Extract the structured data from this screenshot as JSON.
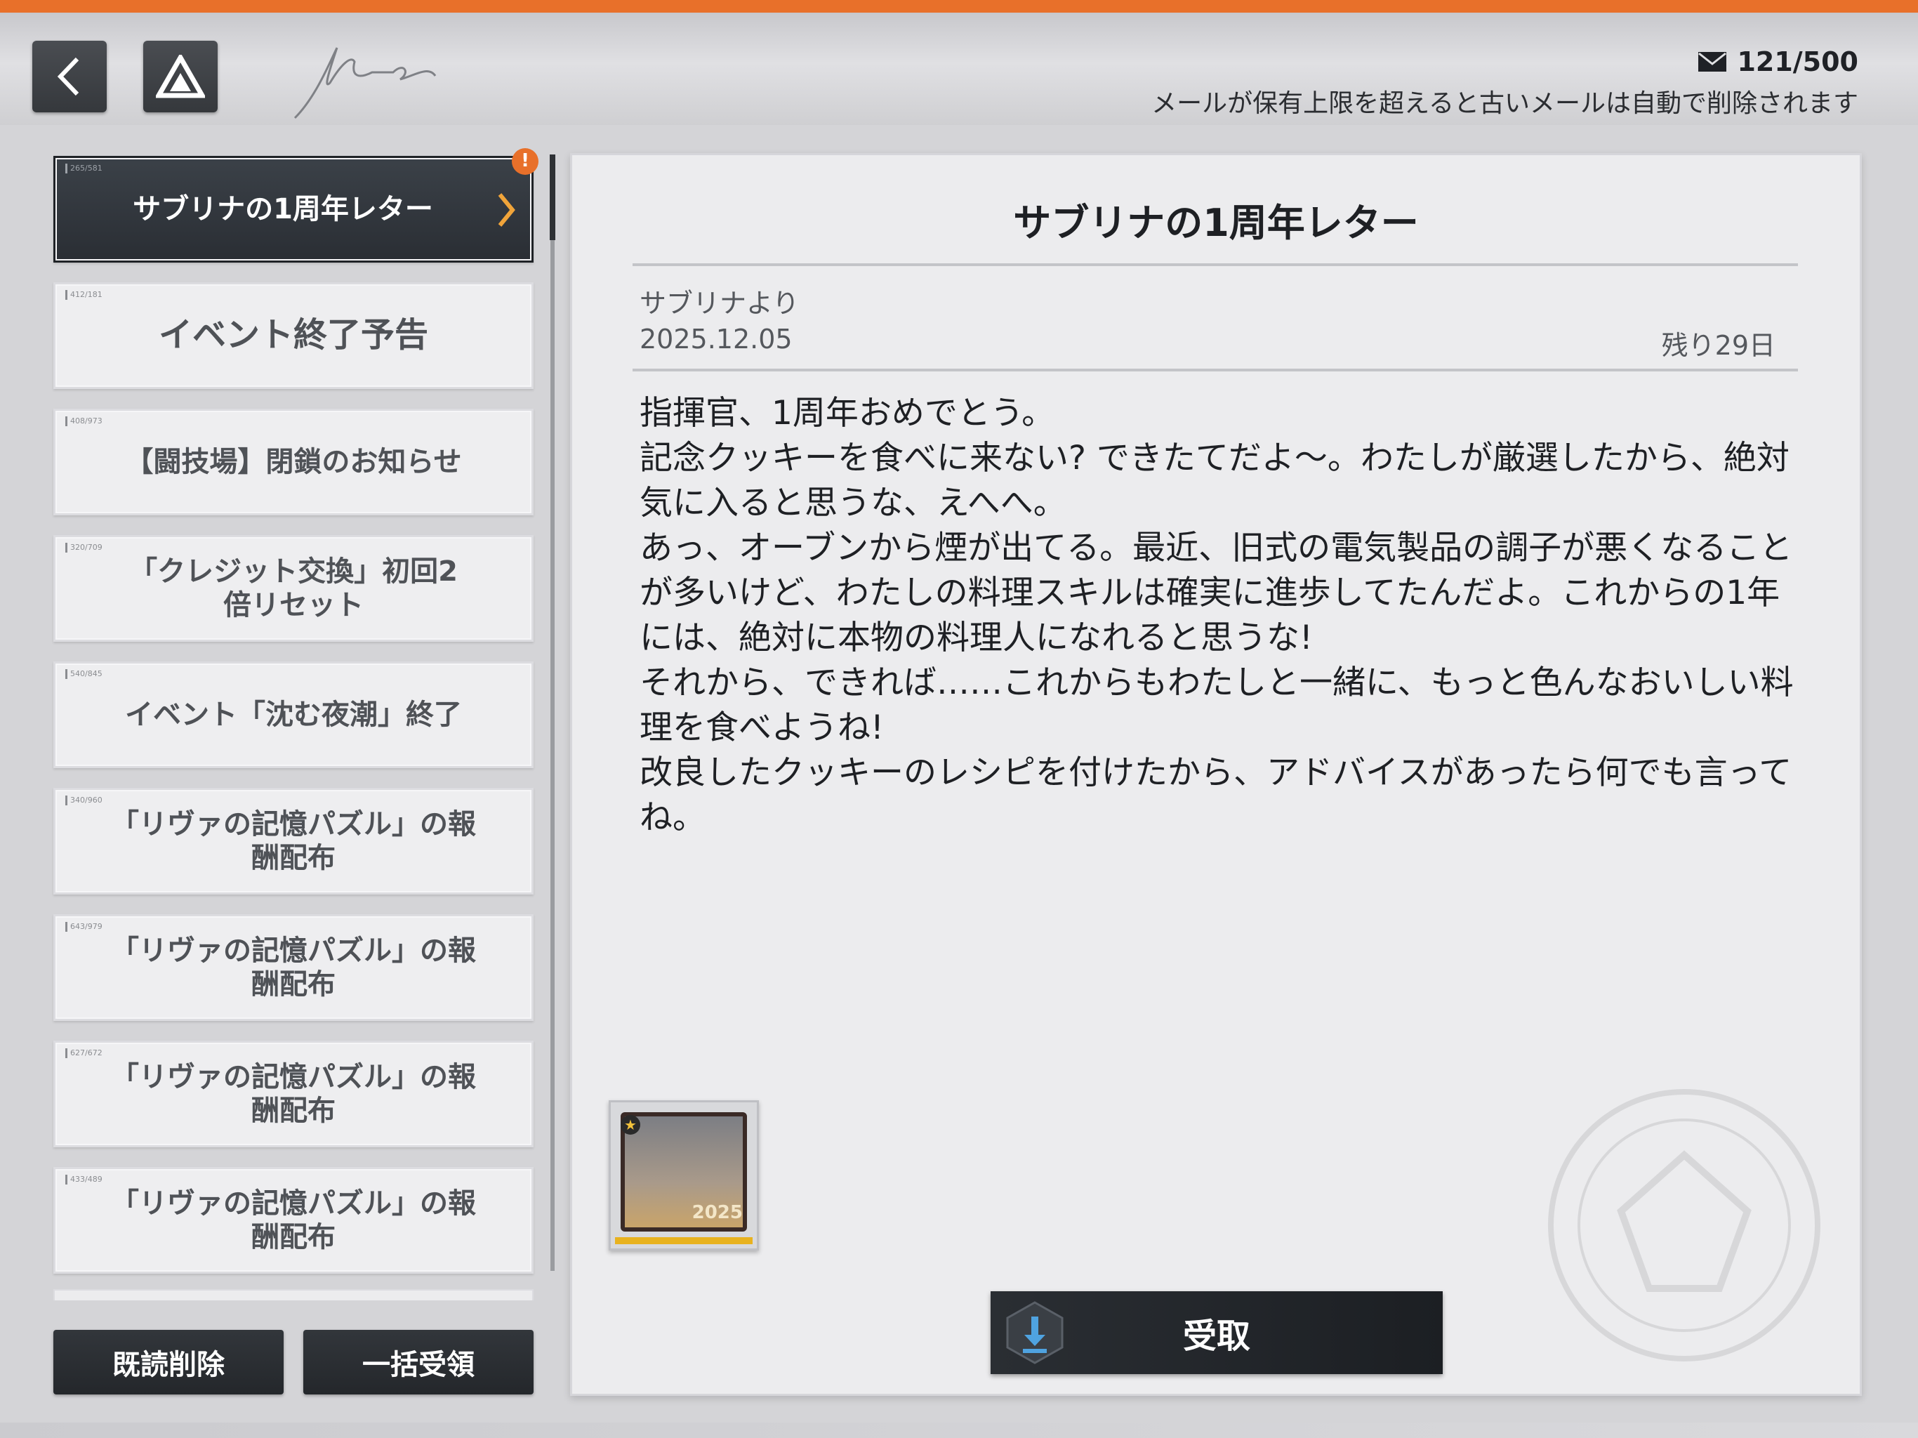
{
  "header": {
    "mail_count": "121/500",
    "mail_note": "メールが保有上限を超えると古いメールは自動で削除されます"
  },
  "colors": {
    "accent": "#e8702a",
    "selected": "#2f3439",
    "reward_bar": "#e8b21f"
  },
  "icons": {
    "back": "chevron-left-icon",
    "home": "logo-triangle-icon",
    "mail": "envelope-icon",
    "alert": "exclamation-badge-icon",
    "download": "download-icon"
  },
  "mail_list": [
    {
      "tag": "265/581",
      "title": "サブリナの1周年レター",
      "selected": true,
      "alert": "!"
    },
    {
      "tag": "412/181",
      "title": "イベント終了予告"
    },
    {
      "tag": "408/973",
      "title": "【闘技場】閉鎖のお知らせ"
    },
    {
      "tag": "320/709",
      "title": "「クレジット交換」初回2倍リセット"
    },
    {
      "tag": "540/845",
      "title": "イベント「沈む夜潮」終了"
    },
    {
      "tag": "340/960",
      "title": "「リヴァの記憶パズル」の報酬配布"
    },
    {
      "tag": "643/979",
      "title": "「リヴァの記憶パズル」の報酬配布"
    },
    {
      "tag": "627/672",
      "title": "「リヴァの記憶パズル」の報酬配布"
    },
    {
      "tag": "433/489",
      "title": "「リヴァの記憶パズル」の報酬配布"
    }
  ],
  "actions": {
    "delete_read": "既読削除",
    "claim_all": "一括受領"
  },
  "detail": {
    "title": "サブリナの1周年レター",
    "sender": "サブリナより",
    "date": "2025.12.05",
    "remaining": "残り29日",
    "body": [
      "指揮官、1周年おめでとう。",
      "記念クッキーを食べに来ない? できたてだよ〜。わたしが厳選したから、絶対気に入ると思うな、えへへ。",
      "あっ、オーブンから煙が出てる。最近、旧式の電気製品の調子が悪くなることが多いけど、わたしの料理スキルは確実に進歩してたんだよ。これからの1年には、絶対に本物の料理人になれると思うな!",
      "それから、できれば……これからもわたしと一緒に、もっと色んなおいしい料理を食べようね!",
      "改良したクッキーのレシピを付けたから、アドバイスがあったら何でも言ってね。"
    ],
    "reward_year": "2025",
    "receive_label": "受取"
  }
}
